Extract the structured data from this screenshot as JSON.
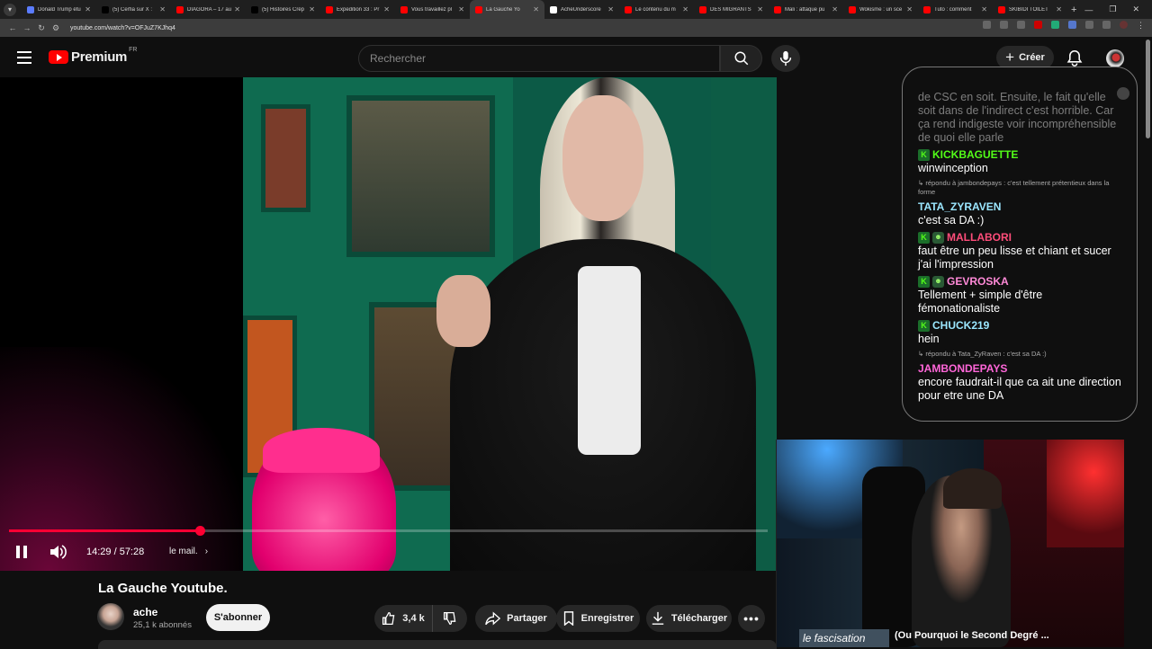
{
  "browser": {
    "tabs": [
      {
        "title": "Donald Trump étu",
        "fav": "#5b7cff"
      },
      {
        "title": "(5) Cerfia sur X :",
        "fav": "#000000"
      },
      {
        "title": "DIAGORA – 17 au",
        "fav": "#ff0000"
      },
      {
        "title": "(5) Histoires Crép",
        "fav": "#000000"
      },
      {
        "title": "Expedition 33 : Pr",
        "fav": "#ff0000"
      },
      {
        "title": "Vous travaillez pl",
        "fav": "#ff0000"
      },
      {
        "title": "La Gauche Yo",
        "fav": "#ff0000"
      },
      {
        "title": "AcheUnderscore",
        "fav": "#ffffff"
      },
      {
        "title": "Le contenu du m",
        "fav": "#ff0000"
      },
      {
        "title": "DES MIGRANTS",
        "fav": "#ff0000"
      },
      {
        "title": "Mali : attaque pu",
        "fav": "#ff0000"
      },
      {
        "title": "Wokisme : un sce",
        "fav": "#ff0000"
      },
      {
        "title": "Tuto : comment",
        "fav": "#ff0000"
      },
      {
        "title": "SKIBIDI TOILET",
        "fav": "#ff0000"
      }
    ],
    "active_tab_index": 6,
    "url": "youtube.com/watch?v=OFJuZ7KJhq4"
  },
  "header": {
    "logo_text": "Premium",
    "logo_sup": "FR",
    "search_placeholder": "Rechercher",
    "create_label": "Créer"
  },
  "player": {
    "current_time": "14:29",
    "duration": "57:28",
    "time_display": "14:29 / 57:28",
    "chapter": "le mail.",
    "progress_fraction": 0.252,
    "buffered_fraction": 0.258
  },
  "chat": {
    "first_text": "de CSC en soit. Ensuite, le fait qu'elle soit dans de l'indirect c'est horrible. Car ça rend indigeste voir incompréhensible de quoi elle parle",
    "messages": [
      {
        "name": "KICKBAGUETTE",
        "color": "#53fc18",
        "badge2": false,
        "reply": "",
        "text": "winwinception"
      },
      {
        "name": "TATA_ZYRAVEN",
        "color": "#9be7ff",
        "badge2": false,
        "reply": "↳ répondu à jambondepays : c'est tellement prétentieux dans la forme",
        "text": "c'est sa DA :)"
      },
      {
        "name": "MALLABORI",
        "color": "#ff4d7a",
        "badge2": true,
        "reply": "",
        "text": "faut être un peu lisse et chiant et sucer j'ai l'impression"
      },
      {
        "name": "GEVROSKA",
        "color": "#ff8ad8",
        "badge2": true,
        "reply": "",
        "text": "Tellement + simple d'être fémonationaliste"
      },
      {
        "name": "CHUCK219",
        "color": "#9be7ff",
        "badge2": false,
        "reply": "",
        "text": "hein"
      },
      {
        "name": "JAMBONDEPAYS",
        "color": "#ff66d9",
        "badge2": false,
        "reply": "↳ répondu à Tata_ZyRaven : c'est sa DA :)",
        "text": "encore faudrait-il que ca ait une direction pour etre une DA"
      }
    ]
  },
  "webcam": {
    "caption": "le fascisation",
    "next_title": "(Ou Pourquoi le Second Degré ..."
  },
  "video": {
    "title": "La Gauche Youtube.",
    "channel": "ache",
    "subscribers": "25,1 k abonnés",
    "subscribe_label": "S'abonner",
    "likes": "3,4 k",
    "share_label": "Partager",
    "save_label": "Enregistrer",
    "download_label": "Télécharger"
  },
  "colors": {
    "accent": "#ff0033",
    "brand": "#ff0000"
  }
}
